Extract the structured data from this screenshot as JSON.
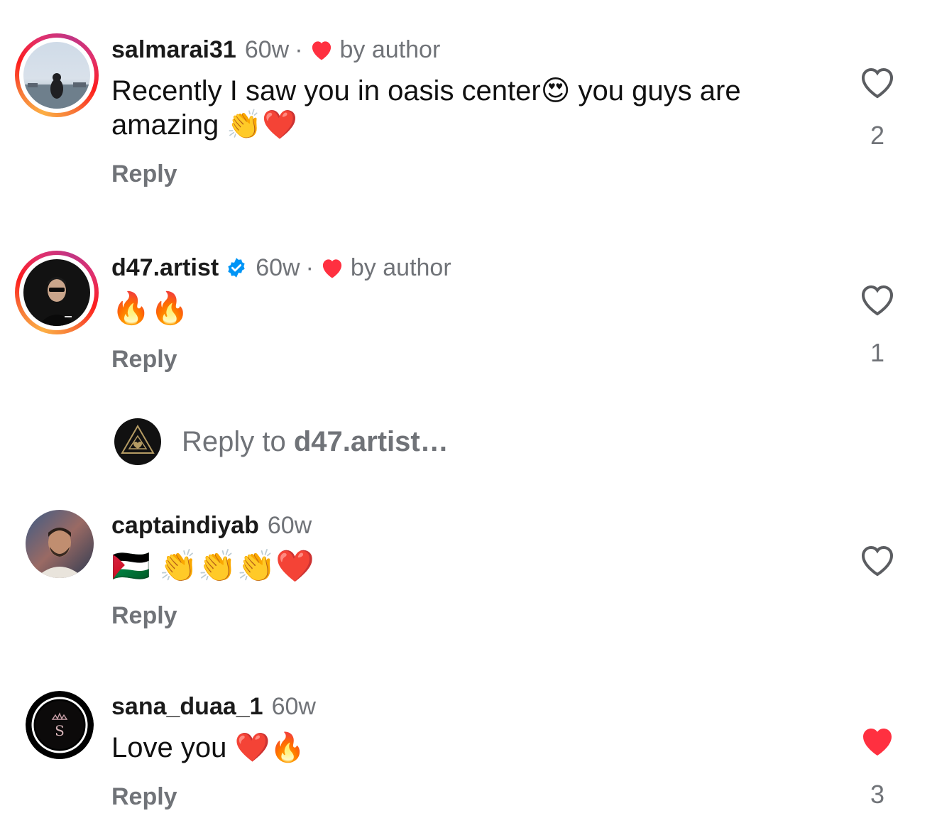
{
  "comments": [
    {
      "username": "salmarai31",
      "time": "60w",
      "separator": "·",
      "by_author": "by author",
      "text": "Recently I saw you in oasis center😍 you guys are amazing 👏❤️",
      "reply": "Reply",
      "likes": "2"
    },
    {
      "username": "d47.artist",
      "time": "60w",
      "separator": "·",
      "by_author": "by author",
      "text": "🔥🔥",
      "reply": "Reply",
      "likes": "1"
    },
    {
      "username": "captaindiyab",
      "time": "60w",
      "text": "🇵🇸 👏👏👏❤️",
      "reply": "Reply",
      "likes": ""
    },
    {
      "username": "sana_duaa_1",
      "time": "60w",
      "text": "Love you ❤️🔥",
      "reply": "Reply",
      "likes": "3"
    }
  ],
  "reply_box": {
    "prefix": "Reply to ",
    "target": "d47.artist…"
  },
  "colors": {
    "liked_heart": "#ff3040",
    "muted_text": "#707378",
    "verified": "#0095f6"
  }
}
